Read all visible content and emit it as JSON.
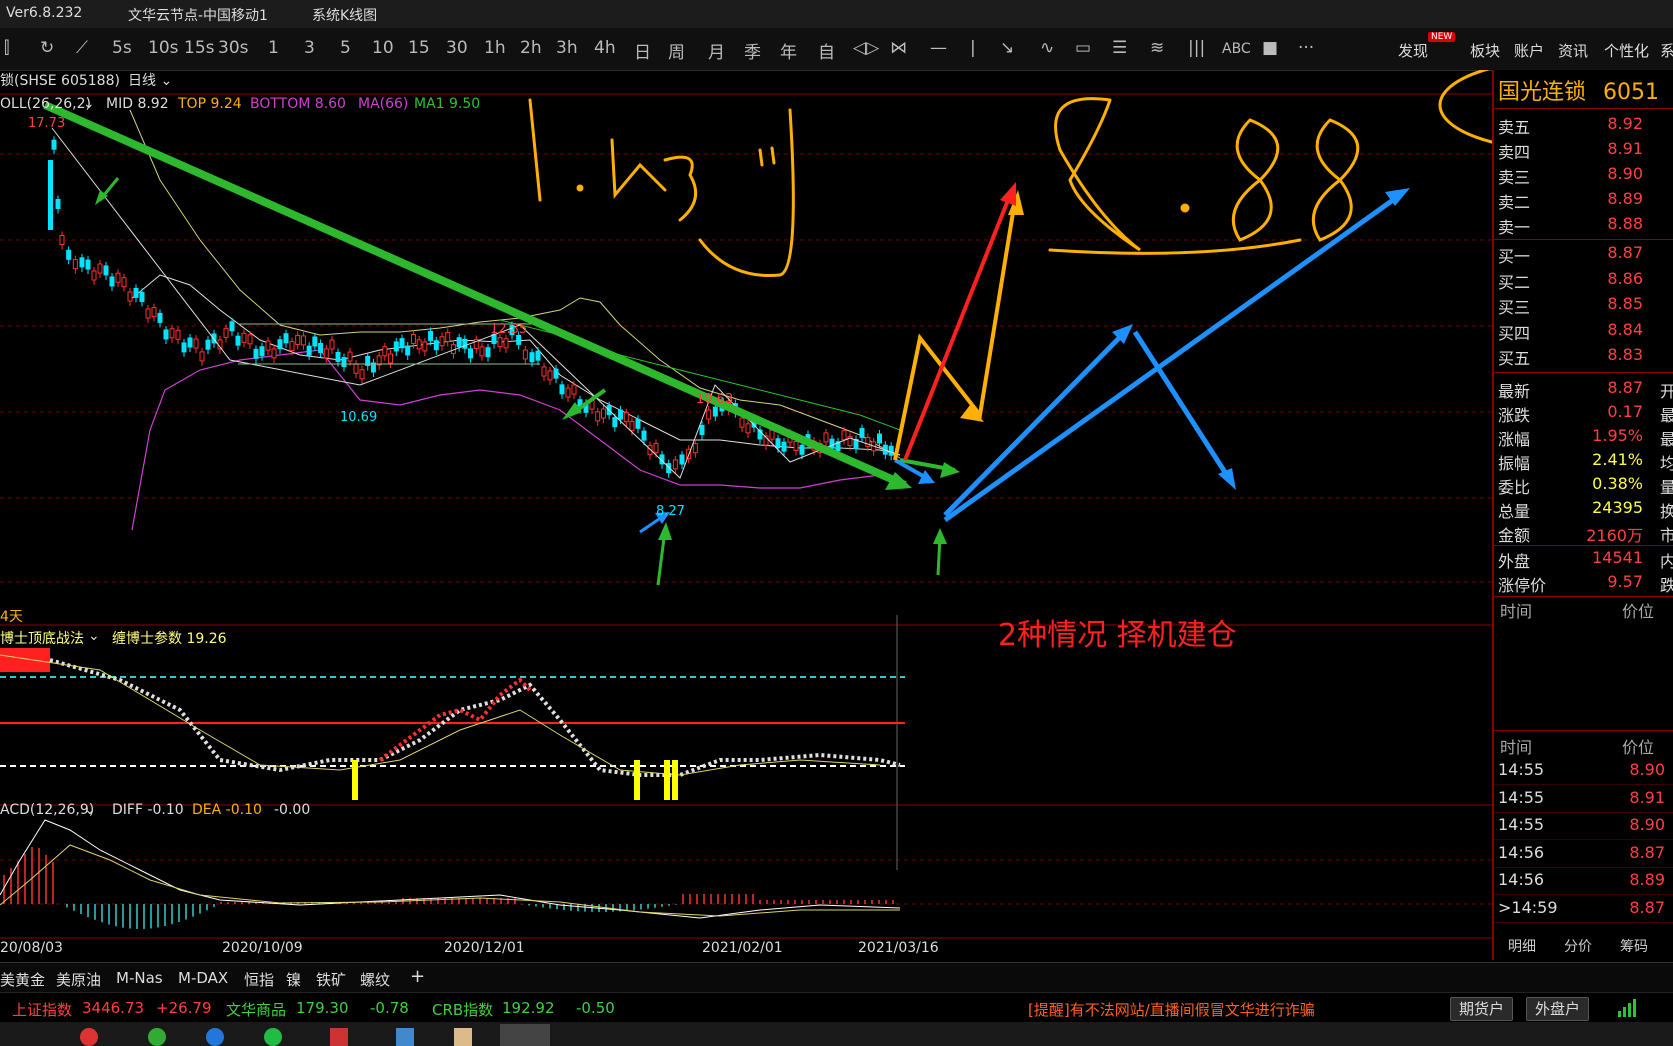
{
  "titlebar": {
    "version": "Ver6.8.232",
    "node": "文华云节点-中国移动1",
    "view": "系统K线图"
  },
  "toolbar": {
    "periods": [
      "5s",
      "10s",
      "15s",
      "30s",
      "1",
      "3",
      "5",
      "10",
      "15",
      "30",
      "1h",
      "2h",
      "3h",
      "4h",
      "日",
      "周",
      "月",
      "季",
      "年",
      "自"
    ],
    "right_menu": [
      "发现",
      "板块",
      "账户",
      "资讯",
      "个性化",
      "系"
    ],
    "new_badge": "NEW"
  },
  "chart": {
    "symbol_label": "锁(SHSE 605188)",
    "period_label": "日线",
    "boll": {
      "name": "OLL(26,26,2)",
      "mid": "MID 8.92",
      "top": "TOP 9.24",
      "bottom": "BOTTOM 8.60",
      "ma66": "MA(66)",
      "ma1": "MA1 9.50"
    },
    "price_labels": {
      "high": "17.73",
      "p1": "12.35",
      "p2": "10.69",
      "p3": "10.63",
      "p4": "8.27"
    },
    "days_label": "4天",
    "indicator2": {
      "name": "博士顶底战法",
      "param": "缠博士参数 19.26"
    },
    "macd": {
      "name": "ACD(12,26,9)",
      "diff": "DIFF -0.10",
      "dea": "DEA -0.10",
      "macd": "-0.00"
    },
    "dates": [
      "20/08/03",
      "2020/10/09",
      "2020/12/01",
      "2021/02/01",
      "2021/03/16"
    ],
    "annotation_text": "2种情况 择机建仓"
  },
  "quote": {
    "name": "国光连锁",
    "code": "6051",
    "asks": [
      {
        "label": "卖五",
        "price": "8.92"
      },
      {
        "label": "卖四",
        "price": "8.91"
      },
      {
        "label": "卖三",
        "price": "8.90"
      },
      {
        "label": "卖二",
        "price": "8.89"
      },
      {
        "label": "卖一",
        "price": "8.88"
      }
    ],
    "bids": [
      {
        "label": "买一",
        "price": "8.87"
      },
      {
        "label": "买二",
        "price": "8.86"
      },
      {
        "label": "买三",
        "price": "8.85"
      },
      {
        "label": "买四",
        "price": "8.84"
      },
      {
        "label": "买五",
        "price": "8.83"
      }
    ],
    "stats": [
      {
        "label": "最新",
        "value": "8.87",
        "extra": "开"
      },
      {
        "label": "涨跌",
        "value": "0.17",
        "extra": "最"
      },
      {
        "label": "涨幅",
        "value": "1.95%",
        "extra": "最"
      },
      {
        "label": "振幅",
        "value": "2.41%",
        "extra": "均"
      },
      {
        "label": "委比",
        "value": "0.38%",
        "extra": "量"
      },
      {
        "label": "总量",
        "value": "24395",
        "extra": "换"
      },
      {
        "label": "金额",
        "value": "2160万",
        "extra": "市"
      }
    ],
    "stats2": [
      {
        "label": "外盘",
        "value": "14541",
        "extra": "内"
      },
      {
        "label": "涨停价",
        "value": "9.57",
        "extra": "跌"
      }
    ],
    "ticks_header": {
      "time": "时间",
      "price": "价位"
    },
    "ticks": [
      {
        "time": "14:55",
        "price": "8.90"
      },
      {
        "time": "14:55",
        "price": "8.91"
      },
      {
        "time": "14:55",
        "price": "8.90"
      },
      {
        "time": "14:56",
        "price": "8.87"
      },
      {
        "time": "14:56",
        "price": "8.89"
      },
      {
        "time": ">14:59",
        "price": "8.87"
      }
    ],
    "tabs": [
      "明细",
      "分价",
      "筹码"
    ]
  },
  "bottom_tabs": [
    "美黄金",
    "美原油",
    "M-Nas",
    "M-DAX",
    "恒指",
    "镍",
    "铁矿",
    "螺纹"
  ],
  "indexes": [
    {
      "name": "上证指数",
      "value": "3446.73",
      "change": "+26.79"
    },
    {
      "name": "文华商品",
      "value": "179.30",
      "change": "-0.78"
    },
    {
      "name": "CRB指数",
      "value": "192.92",
      "change": "-0.50"
    }
  ],
  "warning": "[提醒]有不法网站/直播间假冒文华进行诈骗",
  "buttons": {
    "futures": "期货户",
    "foreign": "外盘户"
  },
  "colors": {
    "up": "#ff3030",
    "down": "#00e5ff",
    "accent_red": "#8b0000",
    "yellow": "#ffff00"
  }
}
